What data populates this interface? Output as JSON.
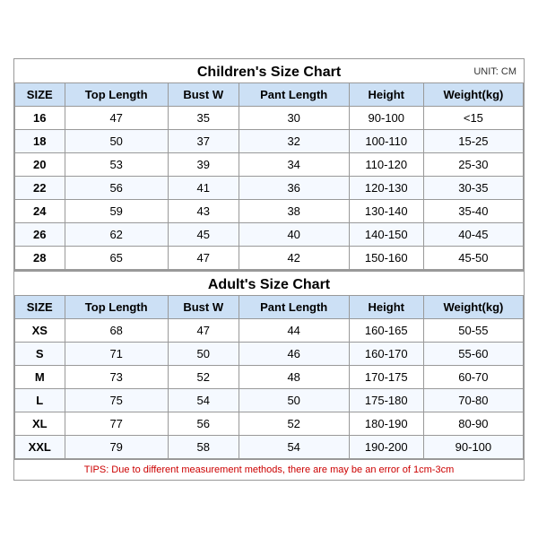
{
  "children_title": "Children's Size Chart",
  "adults_title": "Adult's Size Chart",
  "unit": "UNIT: CM",
  "columns": [
    "SIZE",
    "Top Length",
    "Bust W",
    "Pant Length",
    "Height",
    "Weight(kg)"
  ],
  "children_rows": [
    [
      "16",
      "47",
      "35",
      "30",
      "90-100",
      "<15"
    ],
    [
      "18",
      "50",
      "37",
      "32",
      "100-110",
      "15-25"
    ],
    [
      "20",
      "53",
      "39",
      "34",
      "110-120",
      "25-30"
    ],
    [
      "22",
      "56",
      "41",
      "36",
      "120-130",
      "30-35"
    ],
    [
      "24",
      "59",
      "43",
      "38",
      "130-140",
      "35-40"
    ],
    [
      "26",
      "62",
      "45",
      "40",
      "140-150",
      "40-45"
    ],
    [
      "28",
      "65",
      "47",
      "42",
      "150-160",
      "45-50"
    ]
  ],
  "adult_rows": [
    [
      "XS",
      "68",
      "47",
      "44",
      "160-165",
      "50-55"
    ],
    [
      "S",
      "71",
      "50",
      "46",
      "160-170",
      "55-60"
    ],
    [
      "M",
      "73",
      "52",
      "48",
      "170-175",
      "60-70"
    ],
    [
      "L",
      "75",
      "54",
      "50",
      "175-180",
      "70-80"
    ],
    [
      "XL",
      "77",
      "56",
      "52",
      "180-190",
      "80-90"
    ],
    [
      "XXL",
      "79",
      "58",
      "54",
      "190-200",
      "90-100"
    ]
  ],
  "tips": "TIPS: Due to different measurement methods, there are may be an error of 1cm-3cm"
}
